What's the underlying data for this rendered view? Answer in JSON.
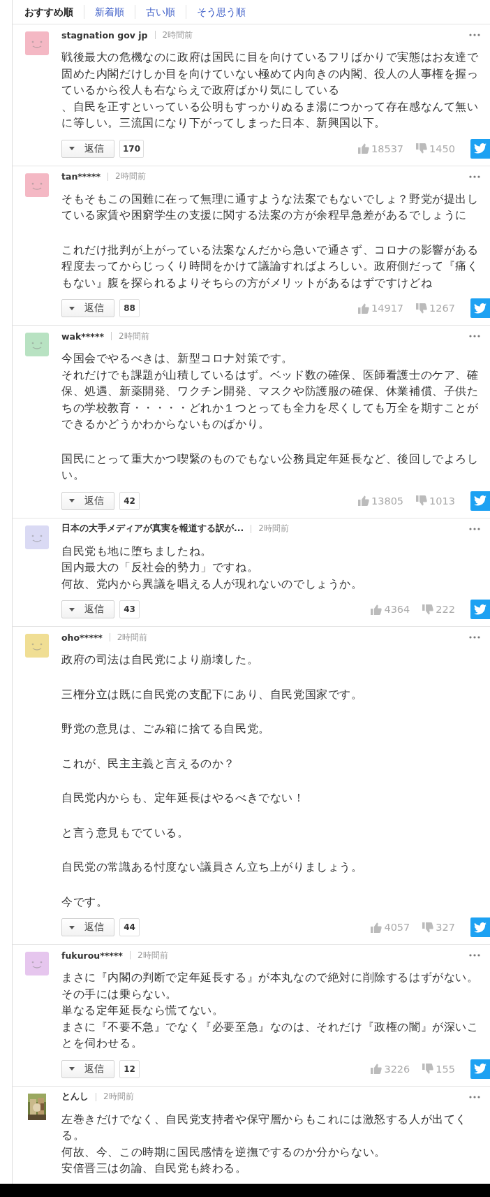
{
  "sort_tabs": [
    {
      "label": "おすすめ順",
      "selected": true
    },
    {
      "label": "新着順",
      "selected": false
    },
    {
      "label": "古い順",
      "selected": false
    },
    {
      "label": "そう思う順",
      "selected": false
    }
  ],
  "comments": [
    {
      "user": "stagnation gov jp",
      "time": "2時間前",
      "avatar": {
        "kind": "smiley",
        "color": "#f4b8c4"
      },
      "paragraphs": [
        [
          "戦後最大の危機なのに政府は国民に目を向けているフリばかりで実態はお友達で固めた内閣だけしか目を向けていない極めて内向きの内閣、役人の人事権を握っているから役人も右ならえで政府ばかり気にしている",
          "、自民を正すといっている公明もすっかりぬるま湯につかって存在感なんて無いに等しい。三流国になり下がってしまった日本、新興国以下。"
        ]
      ],
      "reply_label": "返信",
      "reply_count": "170",
      "likes": "18537",
      "dislikes": "1450"
    },
    {
      "user": "tan*****",
      "time": "2時間前",
      "avatar": {
        "kind": "smiley",
        "color": "#f4b8c4"
      },
      "paragraphs": [
        [
          "そもそもこの国難に在って無理に通すような法案でもないでしょ？野党が提出している家賃や困窮学生の支援に関する法案の方が余程早急差があるでしょうに"
        ],
        [
          "これだけ批判が上がっている法案なんだから急いで通さず、コロナの影響がある程度去ってからじっくり時間をかけて議論すればよろしい。政府側だって『痛くもない』腹を探られるよりそちらの方がメリットがあるはずですけどね"
        ]
      ],
      "reply_label": "返信",
      "reply_count": "88",
      "likes": "14917",
      "dislikes": "1267"
    },
    {
      "user": "wak*****",
      "time": "2時間前",
      "avatar": {
        "kind": "smiley",
        "color": "#b8e2c2"
      },
      "paragraphs": [
        [
          "今国会でやるべきは、新型コロナ対策です。",
          "それだけでも課題が山積しているはず。ベッド数の確保、医師看護士のケア、確保、処遇、新薬開発、ワクチン開発、マスクや防護服の確保、休業補償、子供たちの学校教育・・・・・どれか１つとっても全力を尽くしても万全を期すことができるかどうかわからないものばかり。"
        ],
        [
          "国民にとって重大かつ喫緊のものでもない公務員定年延長など、後回しでよろしい。"
        ]
      ],
      "reply_label": "返信",
      "reply_count": "42",
      "likes": "13805",
      "dislikes": "1013"
    },
    {
      "user": "日本の大手メディアが真実を報道する訳が...",
      "time": "2時間前",
      "avatar": {
        "kind": "smiley",
        "color": "#dadaf4"
      },
      "paragraphs": [
        [
          "自民党も地に堕ちましたね。",
          "国内最大の「反社会的勢力」ですね。",
          "何故、党内から異議を唱える人が現れないのでしょうか。"
        ]
      ],
      "reply_label": "返信",
      "reply_count": "43",
      "likes": "4364",
      "dislikes": "222"
    },
    {
      "user": "oho*****",
      "time": "2時間前",
      "avatar": {
        "kind": "smiley",
        "color": "#f0de94"
      },
      "paragraphs": [
        [
          "政府の司法は自民党により崩壊した。"
        ],
        [
          "三権分立は既に自民党の支配下にあり、自民党国家です。"
        ],
        [
          "野党の意見は、ごみ箱に捨てる自民党。"
        ],
        [
          "これが、民主主義と言えるのか？"
        ],
        [
          "自民党内からも、定年延長はやるべきでない！"
        ],
        [
          "と言う意見もでている。"
        ],
        [
          "自民党の常識ある忖度ない議員さん立ち上がりましょう。"
        ],
        [
          "今です。"
        ]
      ],
      "reply_label": "返信",
      "reply_count": "44",
      "likes": "4057",
      "dislikes": "327"
    },
    {
      "user": "fukurou*****",
      "time": "2時間前",
      "avatar": {
        "kind": "smiley",
        "color": "#e6c6ee"
      },
      "paragraphs": [
        [
          "まさに『内閣の判断で定年延長する』が本丸なので絶対に削除するはずがない。",
          "その手には乗らない。",
          "単なる定年延長なら慌てない。",
          "まさに『不要不急』でなく『必要至急』なのは、それだけ『政権の闇』が深いことを伺わせる。"
        ]
      ],
      "reply_label": "返信",
      "reply_count": "12",
      "likes": "3226",
      "dislikes": "155"
    },
    {
      "user": "とんし",
      "time": "2時間前",
      "avatar": {
        "kind": "picture"
      },
      "paragraphs": [
        [
          "左巻きだけでなく、自民党支持者や保守層からもこれには激怒する人が出てくる。",
          "何故、今、この時期に国民感情を逆撫でするのか分からない。",
          "安倍晋三は勿論、自民党も終わる。"
        ]
      ]
    }
  ]
}
